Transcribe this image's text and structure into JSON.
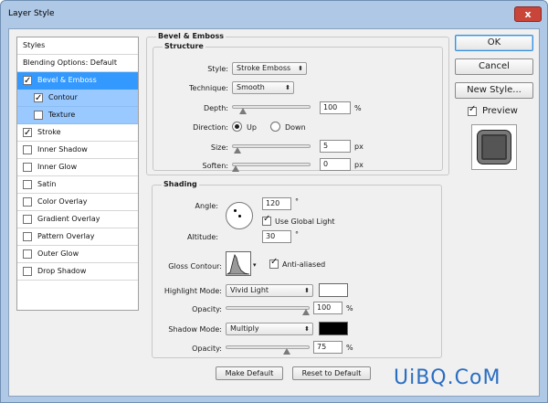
{
  "window": {
    "title": "Layer Style",
    "close_label": "x"
  },
  "sidebar": {
    "items": [
      {
        "label": "Styles",
        "type": "header"
      },
      {
        "label": "Blending Options: Default",
        "type": "header"
      },
      {
        "label": "Bevel & Emboss",
        "checked": true,
        "state": "selected"
      },
      {
        "label": "Contour",
        "checked": true,
        "state": "sub"
      },
      {
        "label": "Texture",
        "checked": false,
        "state": "sub"
      },
      {
        "label": "Stroke",
        "checked": true
      },
      {
        "label": "Inner Shadow",
        "checked": false
      },
      {
        "label": "Inner Glow",
        "checked": false
      },
      {
        "label": "Satin",
        "checked": false
      },
      {
        "label": "Color Overlay",
        "checked": false
      },
      {
        "label": "Gradient Overlay",
        "checked": false
      },
      {
        "label": "Pattern Overlay",
        "checked": false
      },
      {
        "label": "Outer Glow",
        "checked": false
      },
      {
        "label": "Drop Shadow",
        "checked": false
      }
    ]
  },
  "bevel": {
    "section_title": "Bevel & Emboss",
    "structure_title": "Structure",
    "style_label": "Style:",
    "style_value": "Stroke Emboss",
    "technique_label": "Technique:",
    "technique_value": "Smooth",
    "depth_label": "Depth:",
    "depth_value": "100",
    "depth_unit": "%",
    "depth_fraction": 0.1,
    "direction_label": "Direction:",
    "direction_up": "Up",
    "direction_down": "Down",
    "direction_selected": "Up",
    "size_label": "Size:",
    "size_value": "5",
    "size_unit": "px",
    "size_fraction": 0.02,
    "soften_label": "Soften:",
    "soften_value": "0",
    "soften_unit": "px",
    "soften_fraction": 0.0
  },
  "shading": {
    "title": "Shading",
    "angle_label": "Angle:",
    "angle_value": "120",
    "angle_unit": "°",
    "use_global_light_label": "Use Global Light",
    "use_global_light": true,
    "altitude_label": "Altitude:",
    "altitude_value": "30",
    "altitude_unit": "°",
    "gloss_contour_label": "Gloss Contour:",
    "anti_aliased_label": "Anti-aliased",
    "anti_aliased": true,
    "highlight_mode_label": "Highlight Mode:",
    "highlight_mode_value": "Vivid Light",
    "highlight_color": "#ffffff",
    "highlight_opacity_label": "Opacity:",
    "highlight_opacity_value": "100",
    "highlight_opacity_fraction": 1.0,
    "shadow_mode_label": "Shadow Mode:",
    "shadow_mode_value": "Multiply",
    "shadow_color": "#000000",
    "shadow_opacity_label": "Opacity:",
    "shadow_opacity_value": "75",
    "shadow_opacity_fraction": 0.75,
    "percent_unit": "%"
  },
  "footer": {
    "make_default": "Make Default",
    "reset_default": "Reset to Default"
  },
  "actions": {
    "ok": "OK",
    "cancel": "Cancel",
    "new_style": "New Style...",
    "preview_label": "Preview",
    "preview_checked": true
  },
  "watermark": "UiBQ.CoM",
  "icons": {
    "dropdown": "chevron-updown-icon",
    "contour_dropdown": "triangle-down-icon",
    "check": "checkmark-icon"
  }
}
